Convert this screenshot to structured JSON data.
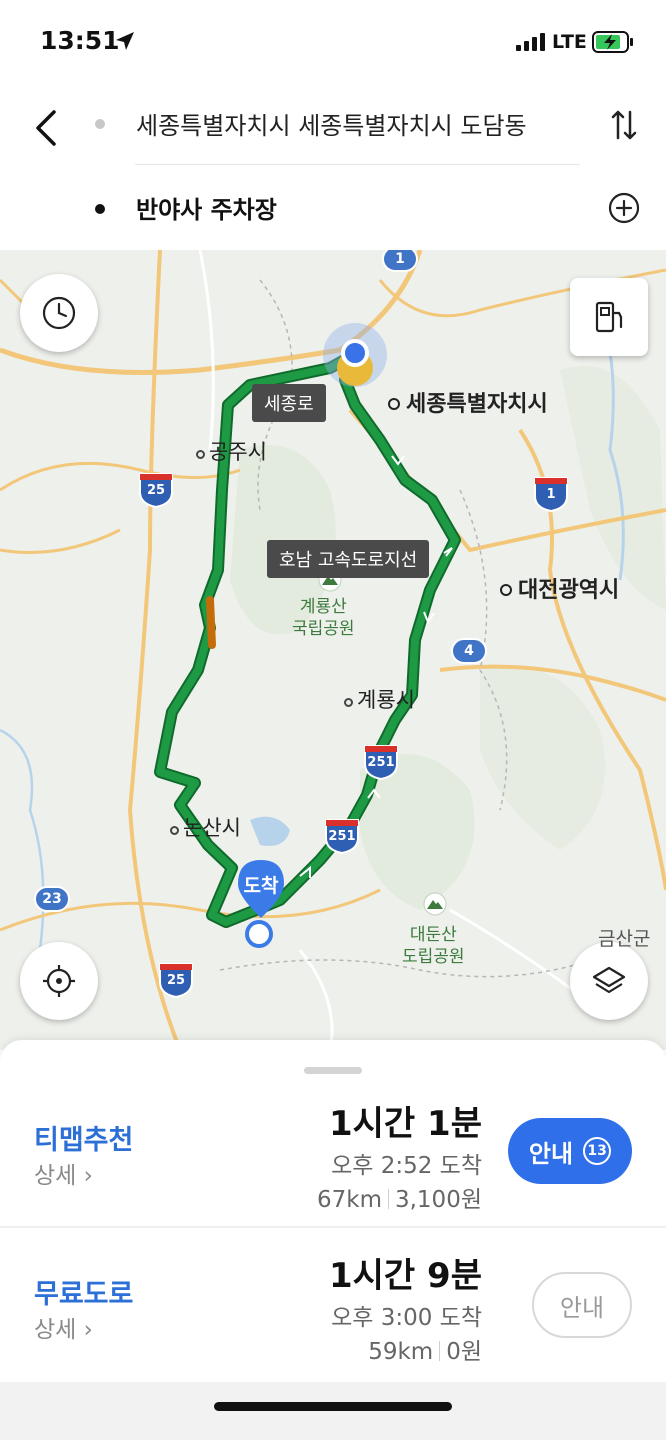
{
  "status_bar": {
    "time": "13:51",
    "network": "LTE"
  },
  "search": {
    "origin": "세종특별자치시 세종특별자치시 도담동",
    "destination": "반야사 주차장"
  },
  "map": {
    "labels": {
      "sejong_city": "세종특별자치시",
      "gongju": "공주시",
      "daejeon": "대전광역시",
      "gyeryong_park": "계룡산\n국립공원",
      "gyeryong": "계룡시",
      "nonsan": "논산시",
      "daedunsan": "대둔산\n도립공원",
      "geumsan": "금산군"
    },
    "tags": {
      "sejong_ro": "세종로",
      "honam_branch": "호남 고속도로지선"
    },
    "highway_shields": [
      "25",
      "1",
      "251",
      "251",
      "25"
    ],
    "national_roads": [
      "1",
      "4",
      "23"
    ],
    "arrival_pin": "도착",
    "route_color": "#1e9a45"
  },
  "routes": [
    {
      "name": "티맵추천",
      "detail": "상세",
      "duration": "1시간 1분",
      "arrival": "오후 2:52 도착",
      "distance": "67km",
      "toll": "3,100원",
      "button_label": "안내",
      "button_badge": "13"
    },
    {
      "name": "무료도로",
      "detail": "상세",
      "duration": "1시간 9분",
      "arrival": "오후 3:00 도착",
      "distance": "59km",
      "toll": "0원",
      "button_label": "안내"
    }
  ]
}
